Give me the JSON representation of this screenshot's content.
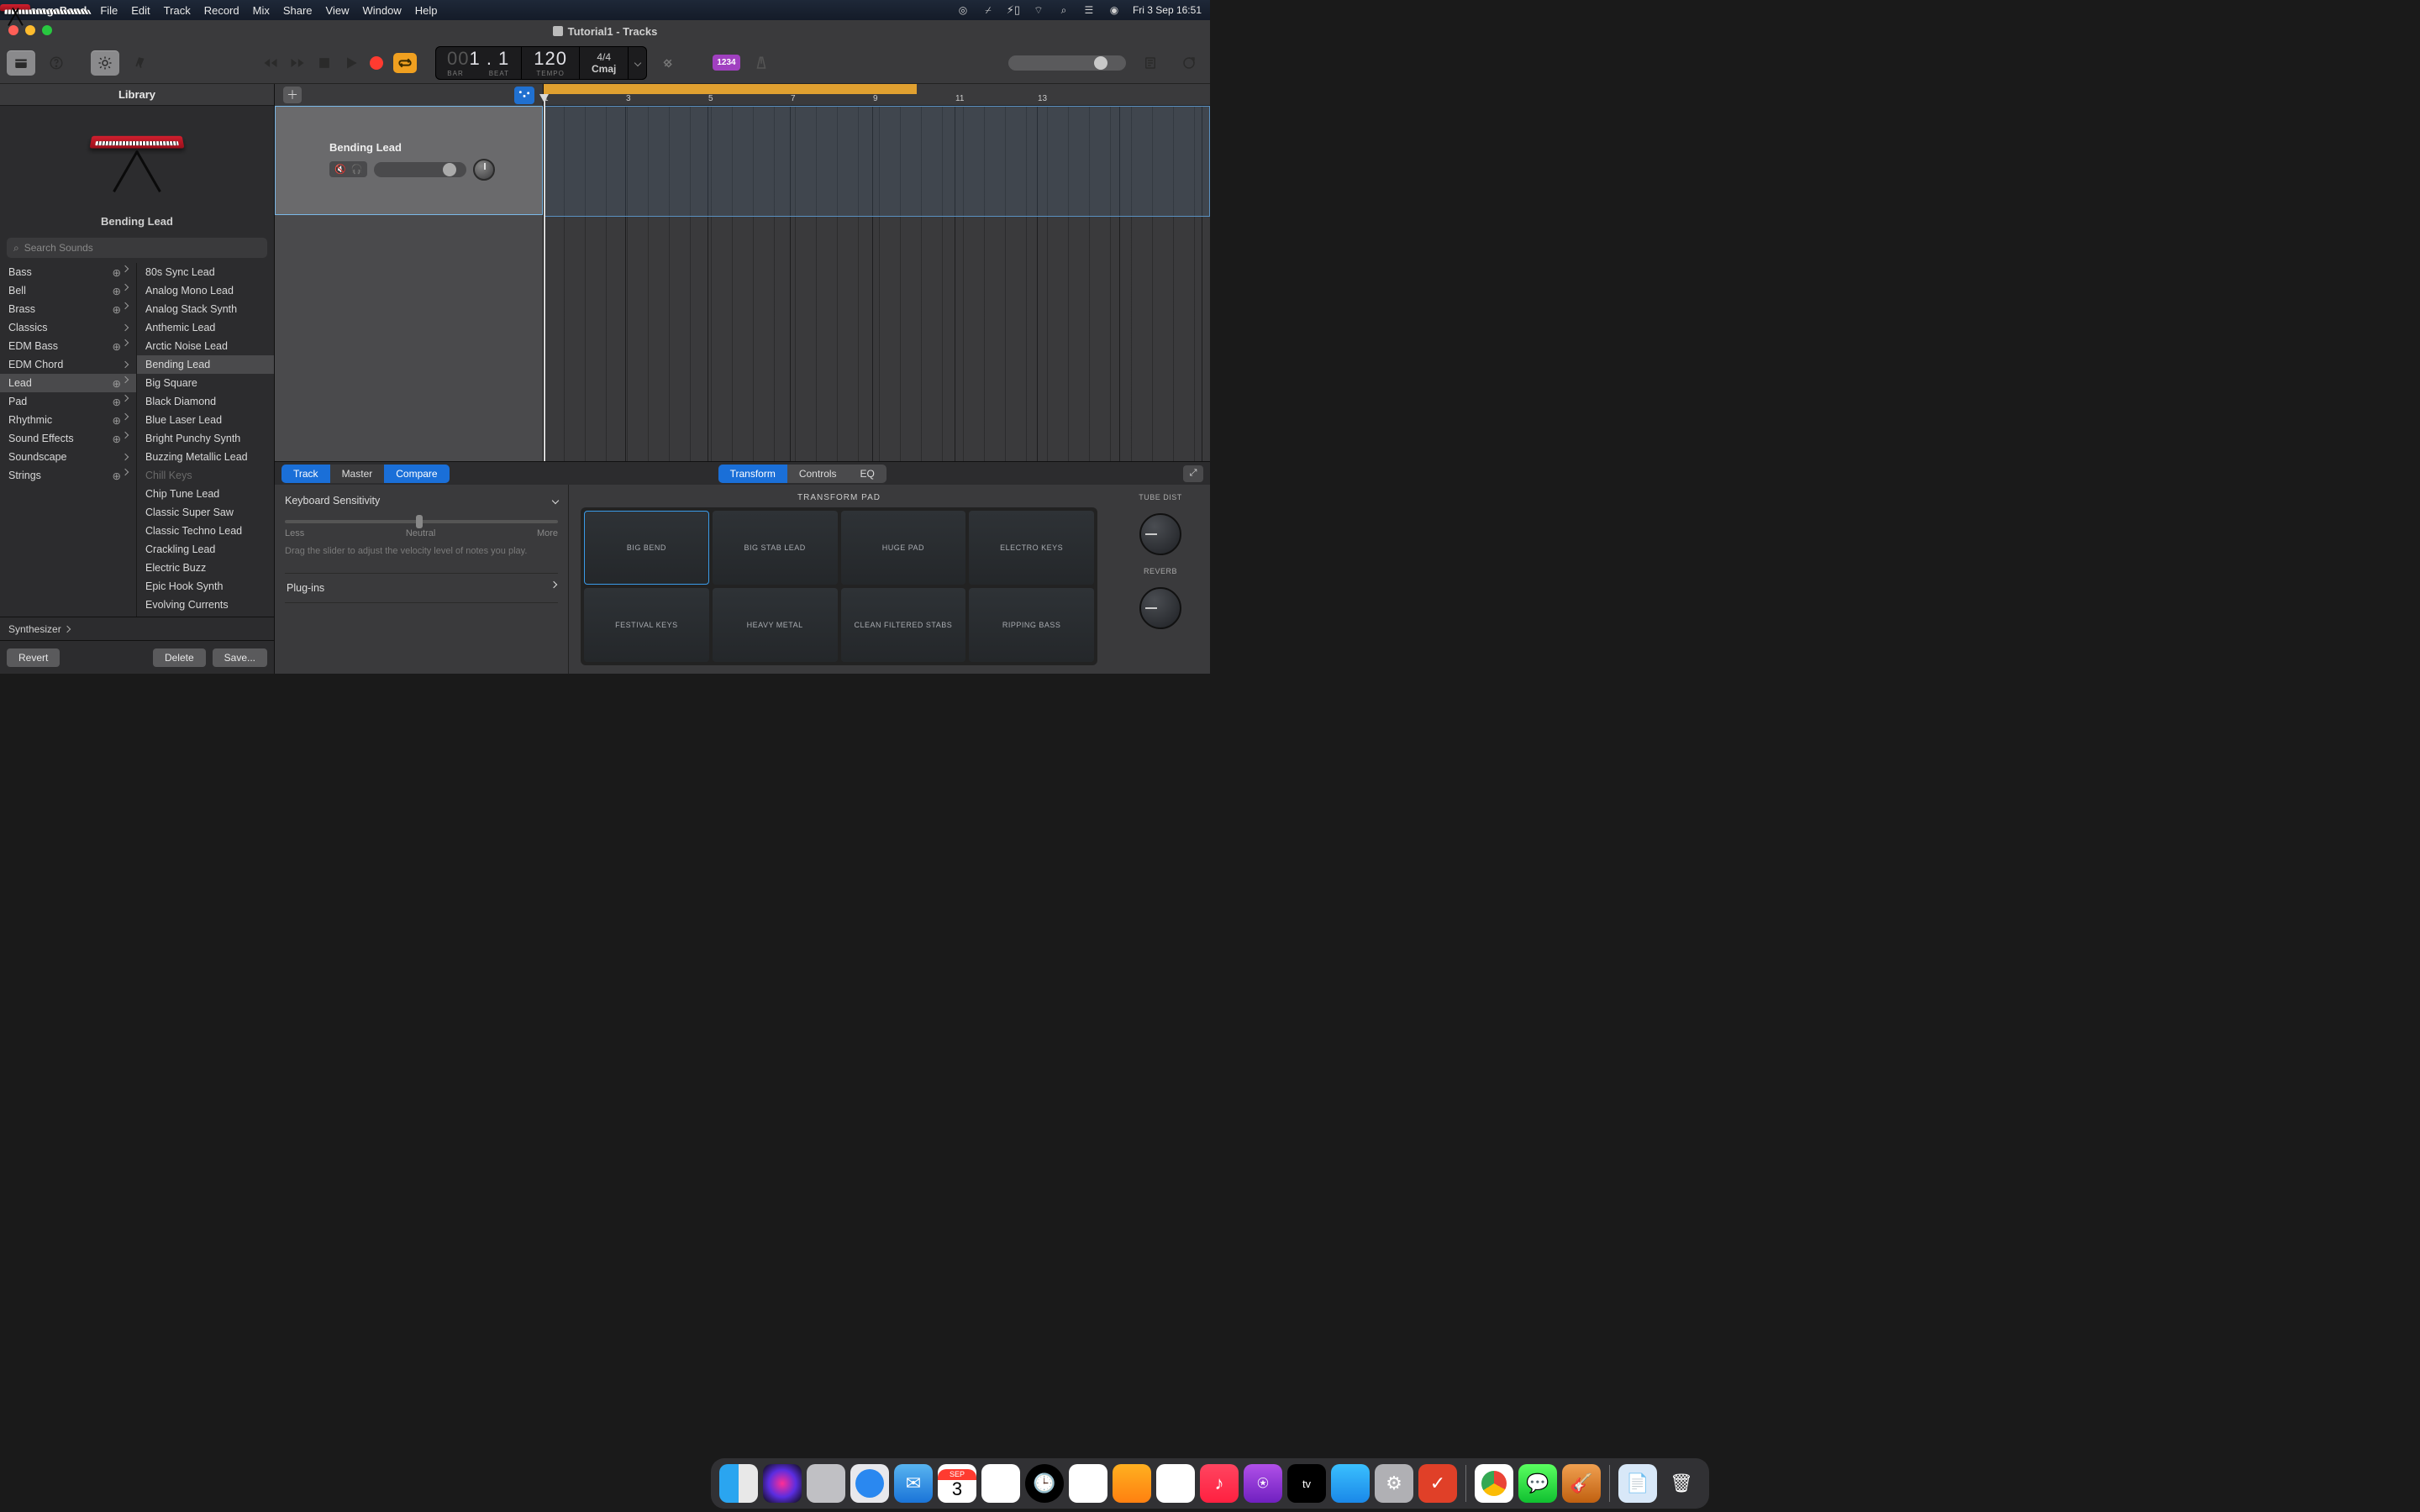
{
  "menubar": {
    "app": "GarageBand",
    "items": [
      "File",
      "Edit",
      "Track",
      "Record",
      "Mix",
      "Share",
      "View",
      "Window",
      "Help"
    ],
    "clock": "Fri 3 Sep  16:51"
  },
  "window": {
    "title": "Tutorial1 - Tracks"
  },
  "transport": {
    "bar": "00",
    "beat": "1 . 1",
    "bar_label": "BAR",
    "beat_label": "BEAT",
    "tempo": "120",
    "tempo_label": "TEMPO",
    "sig": "4/4",
    "key": "Cmaj",
    "count_in": "1234"
  },
  "library": {
    "title": "Library",
    "patch_name": "Bending Lead",
    "search_ph": "Search Sounds",
    "categories": [
      {
        "label": "Bass",
        "dl": true,
        "more": true
      },
      {
        "label": "Bell",
        "dl": true,
        "more": true
      },
      {
        "label": "Brass",
        "dl": true,
        "more": true
      },
      {
        "label": "Classics",
        "dl": false,
        "more": true
      },
      {
        "label": "EDM Bass",
        "dl": true,
        "more": true
      },
      {
        "label": "EDM Chord",
        "dl": false,
        "more": true
      },
      {
        "label": "Lead",
        "dl": true,
        "more": true,
        "selected": true
      },
      {
        "label": "Pad",
        "dl": true,
        "more": true
      },
      {
        "label": "Rhythmic",
        "dl": true,
        "more": true
      },
      {
        "label": "Sound Effects",
        "dl": true,
        "more": true
      },
      {
        "label": "Soundscape",
        "dl": false,
        "more": true
      },
      {
        "label": "Strings",
        "dl": true,
        "more": true
      }
    ],
    "patches": [
      {
        "label": "80s Sync Lead"
      },
      {
        "label": "Analog Mono Lead"
      },
      {
        "label": "Analog Stack Synth"
      },
      {
        "label": "Anthemic Lead"
      },
      {
        "label": "Arctic Noise Lead"
      },
      {
        "label": "Bending Lead",
        "selected": true
      },
      {
        "label": "Big Square"
      },
      {
        "label": "Black Diamond"
      },
      {
        "label": "Blue Laser Lead"
      },
      {
        "label": "Bright Punchy Synth"
      },
      {
        "label": "Buzzing Metallic Lead"
      },
      {
        "label": "Chill Keys",
        "dim": true
      },
      {
        "label": "Chip Tune Lead"
      },
      {
        "label": "Classic Super Saw"
      },
      {
        "label": "Classic Techno Lead"
      },
      {
        "label": "Crackling Lead"
      },
      {
        "label": "Electric Buzz"
      },
      {
        "label": "Epic Hook Synth"
      },
      {
        "label": "Evolving Currents"
      }
    ],
    "crumb": "Synthesizer",
    "revert": "Revert",
    "delete": "Delete",
    "save": "Save..."
  },
  "track": {
    "name": "Bending Lead"
  },
  "ruler": {
    "bars": [
      "1",
      "3",
      "5",
      "7",
      "9",
      "11",
      "13"
    ]
  },
  "smart": {
    "tabs1": [
      "Track",
      "Master",
      "Compare"
    ],
    "tabs2": [
      "Transform",
      "Controls",
      "EQ"
    ],
    "sens_title": "Keyboard Sensitivity",
    "sens_less": "Less",
    "sens_neutral": "Neutral",
    "sens_more": "More",
    "sens_desc": "Drag the slider to adjust the velocity level of notes you play.",
    "plugins": "Plug-ins",
    "pad_title": "TRANSFORM PAD",
    "pads": [
      "BIG BEND",
      "BIG STAB LEAD",
      "HUGE PAD",
      "ELECTRO KEYS",
      "FESTIVAL KEYS",
      "HEAVY METAL",
      "CLEAN FILTERED STABS",
      "RIPPING BASS"
    ],
    "knob1": "TUBE DIST",
    "knob2": "REVERB"
  },
  "dock": {
    "cal_month": "SEP",
    "cal_day": "3",
    "tv": "tv"
  }
}
